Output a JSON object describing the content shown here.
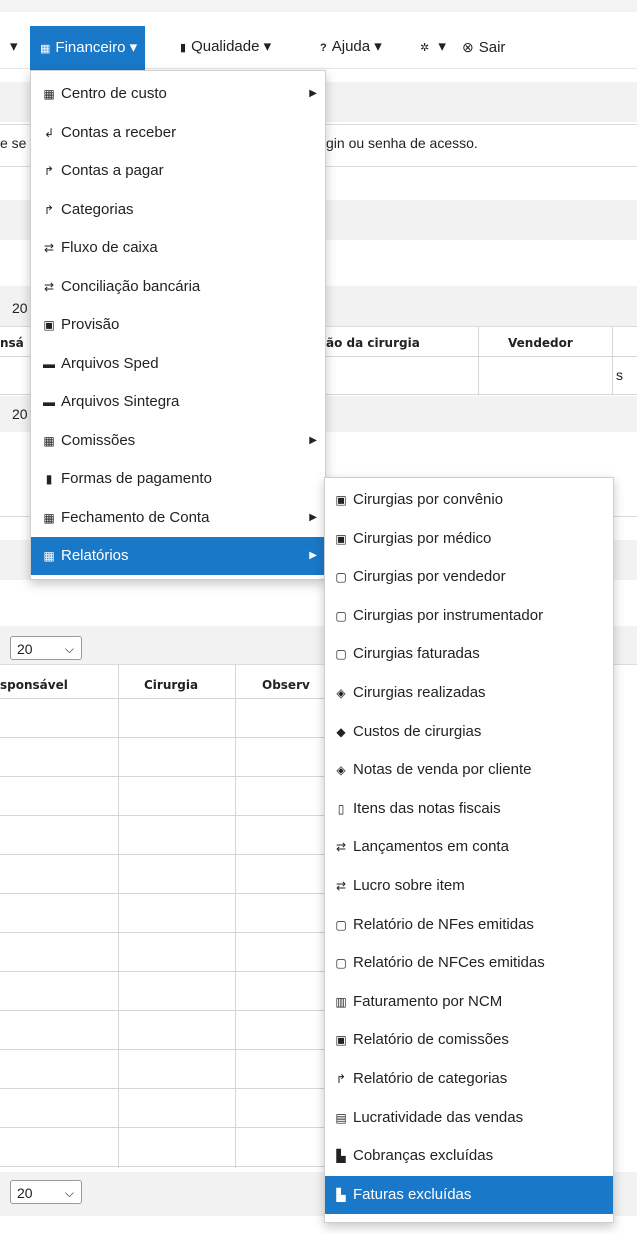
{
  "nav": {
    "leading_caret": "▾",
    "items": [
      {
        "label": "Financeiro",
        "icon": "▦",
        "caret": "▾"
      },
      {
        "label": "Qualidade",
        "icon": "▮",
        "caret": "▾"
      },
      {
        "label": "Ajuda",
        "icon": "?",
        "caret": "▾"
      },
      {
        "label": "",
        "icon": "✲",
        "caret": "▾"
      },
      {
        "label": "Sair",
        "icon": "⊗"
      }
    ]
  },
  "background": {
    "fragment_left": "e se",
    "message": "gin ou senha de acesso.",
    "page_fragment_1": "20",
    "page_fragment_2": "20",
    "table1_headers": [
      "nsá",
      "ão da cirurgia",
      "Vendedor"
    ],
    "table1_cell_fragment": "s",
    "table2_page_select": "20",
    "table2_headers": [
      "sponsável",
      "Cirurgia",
      "Observ"
    ],
    "bottom_page_select": "20"
  },
  "financeiro_menu": [
    {
      "label": "Centro de custo",
      "icon": "▦",
      "submenu": true
    },
    {
      "label": "Contas a receber",
      "icon": "↲"
    },
    {
      "label": "Contas a pagar",
      "icon": "↱"
    },
    {
      "label": "Categorias",
      "icon": "↱"
    },
    {
      "label": "Fluxo de caixa",
      "icon": "⇄"
    },
    {
      "label": "Conciliação bancária",
      "icon": "⇄"
    },
    {
      "label": "Provisão",
      "icon": "▣"
    },
    {
      "label": "Arquivos Sped",
      "icon": "▬"
    },
    {
      "label": "Arquivos Sintegra",
      "icon": "▬"
    },
    {
      "label": "Comissões",
      "icon": "▦",
      "submenu": true
    },
    {
      "label": "Formas de pagamento",
      "icon": "▮"
    },
    {
      "label": "Fechamento de Conta",
      "icon": "▦",
      "submenu": true
    },
    {
      "label": "Relatórios",
      "icon": "▦",
      "submenu": true,
      "active": true
    }
  ],
  "relatorios_menu": [
    {
      "label": "Cirurgias por convênio",
      "icon": "▣"
    },
    {
      "label": "Cirurgias por médico",
      "icon": "▣"
    },
    {
      "label": "Cirurgias por vendedor",
      "icon": "▢"
    },
    {
      "label": "Cirurgias por instrumentador",
      "icon": "▢"
    },
    {
      "label": "Cirurgias faturadas",
      "icon": "▢"
    },
    {
      "label": "Cirurgias realizadas",
      "icon": "◈"
    },
    {
      "label": "Custos de cirurgias",
      "icon": "◆"
    },
    {
      "label": "Notas de venda por cliente",
      "icon": "◈"
    },
    {
      "label": "Itens das notas fiscais",
      "icon": "▯"
    },
    {
      "label": "Lançamentos em conta",
      "icon": "⇄"
    },
    {
      "label": "Lucro sobre item",
      "icon": "⇄"
    },
    {
      "label": "Relatório de NFes emitidas",
      "icon": "▢"
    },
    {
      "label": "Relatório de NFCes emitidas",
      "icon": "▢"
    },
    {
      "label": "Faturamento por NCM",
      "icon": "▥"
    },
    {
      "label": "Relatório de comissões",
      "icon": "▣"
    },
    {
      "label": "Relatório de categorias",
      "icon": "↱"
    },
    {
      "label": "Lucratividade das vendas",
      "icon": "▤"
    },
    {
      "label": "Cobranças excluídas",
      "icon": "▙"
    },
    {
      "label": "Faturas excluídas",
      "icon": "▙",
      "active": true
    }
  ],
  "colors": {
    "accent": "#1a78c9"
  }
}
